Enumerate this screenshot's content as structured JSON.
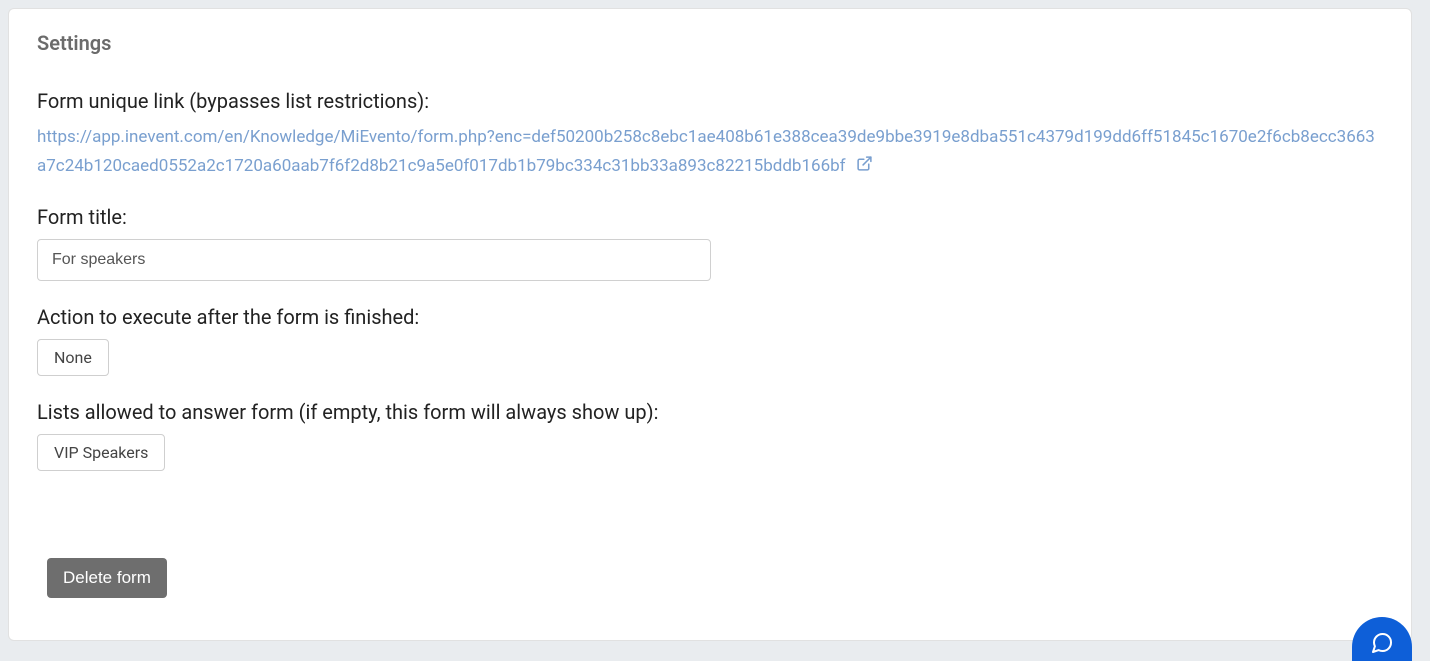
{
  "panel": {
    "title": "Settings",
    "link_label": "Form unique link (bypasses list restrictions):",
    "link_url": "https://app.inevent.com/en/Knowledge/MiEvento/form.php?enc=def50200b258c8ebc1ae408b61e388cea39de9bbe3919e8dba551c4379d199dd6ff51845c1670e2f6cb8ecc3663a7c24b120caed0552a2c1720a60aab7f6f2d8b21c9a5e0f017db1b79bc334c31bb33a893c82215bddb166bf",
    "title_label": "Form title:",
    "title_value": "For speakers",
    "action_label": "Action to execute after the form is finished:",
    "action_value": "None",
    "lists_label": "Lists allowed to answer form (if empty, this form will always show up):",
    "lists_value": "VIP Speakers",
    "delete_label": "Delete form"
  },
  "icons": {
    "external": "external-link-icon",
    "chat": "chat-icon"
  }
}
